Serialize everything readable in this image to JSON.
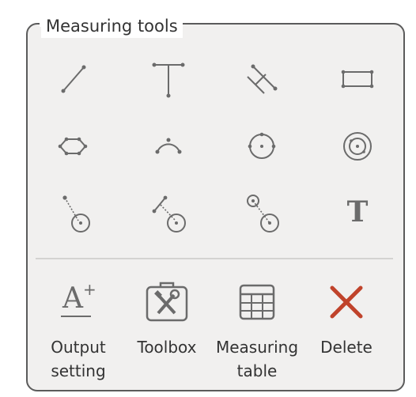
{
  "panel": {
    "title": "Measuring tools"
  },
  "tools": [
    {
      "name": "line"
    },
    {
      "name": "perpendicular-line"
    },
    {
      "name": "parallel-lines"
    },
    {
      "name": "rectangle"
    },
    {
      "name": "polygon"
    },
    {
      "name": "arc"
    },
    {
      "name": "circle"
    },
    {
      "name": "concentric-circles"
    },
    {
      "name": "point-to-circle"
    },
    {
      "name": "line-to-circle"
    },
    {
      "name": "circle-to-circle"
    },
    {
      "name": "text"
    }
  ],
  "text_tool_glyph": "T",
  "text_setting_glyph": "A",
  "text_setting_plus": "+",
  "actions": [
    {
      "label_line1": "Output",
      "label_line2": "setting"
    },
    {
      "label_line1": "Toolbox",
      "label_line2": ""
    },
    {
      "label_line1": "Measuring",
      "label_line2": "table"
    },
    {
      "label_line1": "Delete",
      "label_line2": ""
    }
  ],
  "colors": {
    "icon": "#6b6b6b",
    "delete": "#c0432b",
    "border": "#5b5b5b",
    "panel_bg": "#f1f0ef"
  }
}
